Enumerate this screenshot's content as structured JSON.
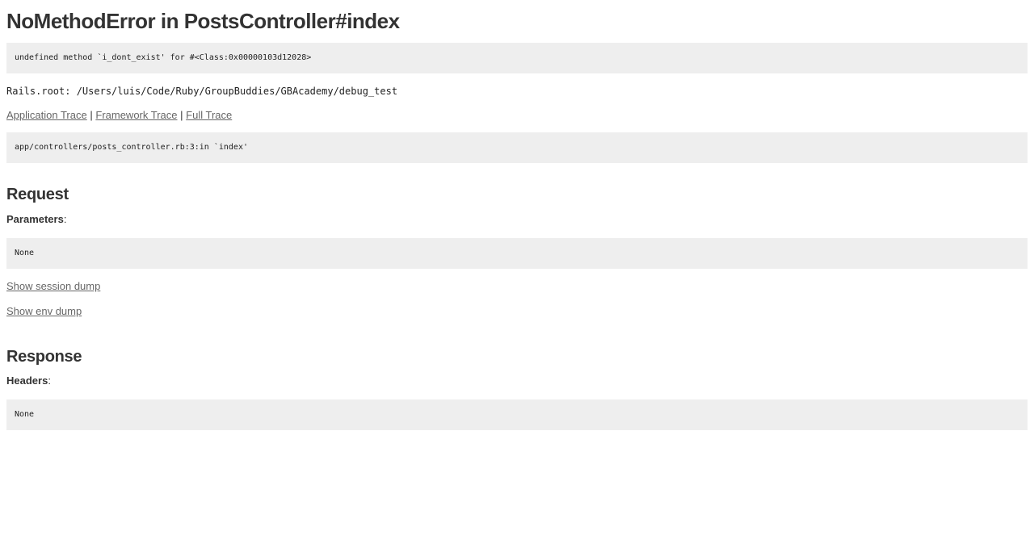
{
  "error": {
    "title": "NoMethodError in PostsController#index",
    "message": "undefined method `i_dont_exist' for #<Class:0x00000103d12028>"
  },
  "rails_root": "Rails.root: /Users/luis/Code/Ruby/GroupBuddies/GBAcademy/debug_test",
  "trace": {
    "links": [
      "Application Trace",
      "Framework Trace",
      "Full Trace"
    ],
    "separator": "|",
    "lines": "app/controllers/posts_controller.rb:3:in `index'"
  },
  "request": {
    "heading": "Request",
    "parameters_label": "Parameters",
    "colon": ":",
    "parameters_value": "None",
    "session_dump_link": "Show session dump",
    "env_dump_link": "Show env dump"
  },
  "response": {
    "heading": "Response",
    "headers_label": "Headers",
    "colon": ":",
    "headers_value": "None"
  }
}
